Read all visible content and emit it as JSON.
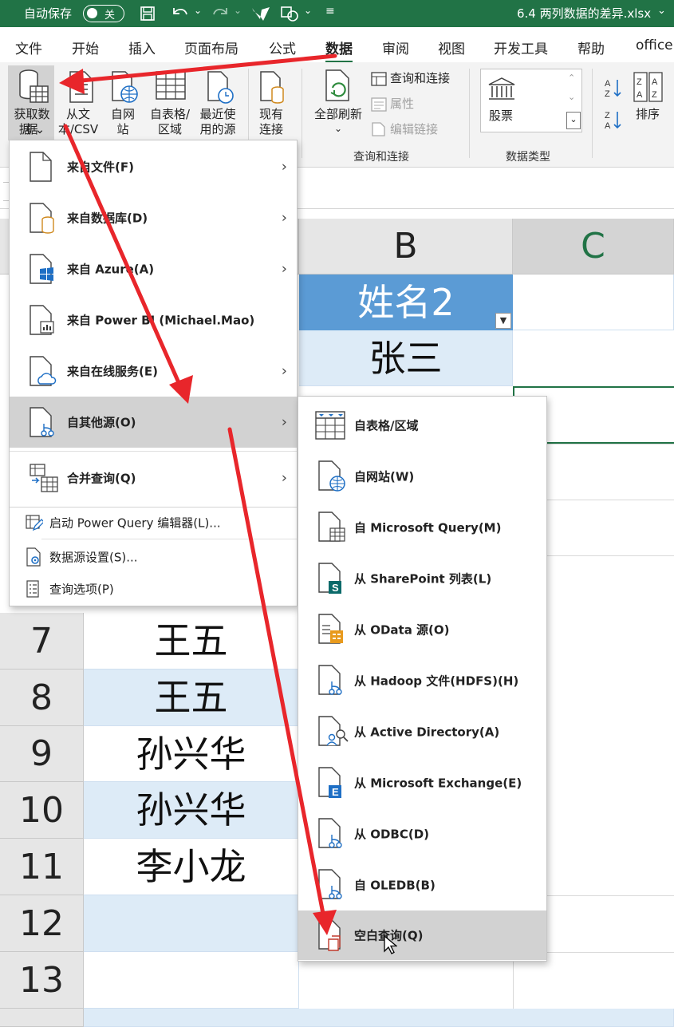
{
  "titlebar": {
    "autosave": "自动保存",
    "toggle": "关",
    "filename": "6.4 两列数据的差异.xlsx",
    "chev": "⌄"
  },
  "tabs": [
    "文件",
    "开始",
    "插入",
    "页面布局",
    "公式",
    "数据",
    "审阅",
    "视图",
    "开发工具",
    "帮助",
    "office"
  ],
  "active_tab": "数据",
  "ribbon": {
    "get_data": "获取数据",
    "get_data2": "据 ⌄",
    "from_text": "从文本/CSV",
    "from_web": "自网站",
    "from_table": "自表格/区域",
    "recent": "最近使用的源",
    "existing": "现有连接",
    "refresh_all": "全部刷新",
    "queries_conn": "查询和连接",
    "properties": "属性",
    "edit_links": "编辑链接",
    "group_queries": "查询和连接",
    "stocks": "股票",
    "group_datatypes": "数据类型",
    "sort": "排序"
  },
  "sheet": {
    "col_b": "B",
    "col_c": "C",
    "header_b": "姓名2",
    "rows": [
      {
        "num": "",
        "value": "张三"
      },
      {
        "num": "7",
        "value": "王五"
      },
      {
        "num": "8",
        "value": "王五"
      },
      {
        "num": "9",
        "value": "孙兴华"
      },
      {
        "num": "10",
        "value": "孙兴华"
      },
      {
        "num": "11",
        "value": "李小龙"
      },
      {
        "num": "12",
        "value": ""
      },
      {
        "num": "13",
        "value": ""
      }
    ]
  },
  "menu": {
    "items": [
      {
        "label": "来自文件(F)",
        "icon": "file-icon"
      },
      {
        "label": "来自数据库(D)",
        "icon": "database-icon"
      },
      {
        "label": "来自 Azure(A)",
        "icon": "azure-icon"
      },
      {
        "label": "来自 Power BI (Michael.Mao)",
        "icon": "powerbi-icon"
      },
      {
        "label": "来自在线服务(E)",
        "icon": "cloud-icon"
      },
      {
        "label": "自其他源(O)",
        "icon": "other-source-icon"
      },
      {
        "label": "合并查询(Q)",
        "icon": "combine-icon"
      }
    ],
    "small": [
      {
        "label": "启动 Power Query 编辑器(L)...",
        "icon": "editor-icon"
      },
      {
        "label": "数据源设置(S)...",
        "icon": "settings-icon"
      },
      {
        "label": "查询选项(P)",
        "icon": "options-icon"
      }
    ],
    "arrow": "›"
  },
  "submenu": [
    {
      "label": "自表格/区域",
      "icon": "table-icon"
    },
    {
      "label": "自网站(W)",
      "icon": "web-icon"
    },
    {
      "label": "自 Microsoft Query(M)",
      "icon": "msquery-icon"
    },
    {
      "label": "从 SharePoint 列表(L)",
      "icon": "sharepoint-icon"
    },
    {
      "label": "从 OData 源(O)",
      "icon": "odata-icon"
    },
    {
      "label": "从 Hadoop 文件(HDFS)(H)",
      "icon": "hadoop-icon"
    },
    {
      "label": "从 Active Directory(A)",
      "icon": "directory-icon"
    },
    {
      "label": "从 Microsoft Exchange(E)",
      "icon": "exchange-icon"
    },
    {
      "label": "从 ODBC(D)",
      "icon": "odbc-icon"
    },
    {
      "label": "自 OLEDB(B)",
      "icon": "oledb-icon"
    },
    {
      "label": "空白查询(Q)",
      "icon": "blank-query-icon"
    }
  ],
  "colors": {
    "excel_green": "#217346",
    "header_blue": "#5b9bd5",
    "band_blue": "#ddebf7",
    "arrow_red": "#e8262b"
  }
}
